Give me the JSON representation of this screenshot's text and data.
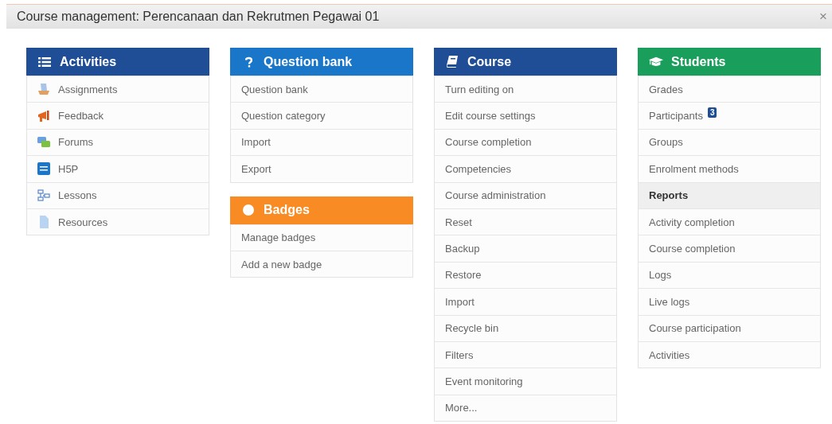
{
  "window": {
    "title": "Course management: Perencanaan dan Rekrutmen Pegawai 01",
    "close": "×"
  },
  "columns": [
    {
      "panels": [
        {
          "title": "Activities",
          "color": "#1f4e96",
          "items": [
            {
              "label": "Assignments",
              "selected": false
            },
            {
              "label": "Feedback",
              "selected": false
            },
            {
              "label": "Forums",
              "selected": false
            },
            {
              "label": "H5P",
              "selected": false
            },
            {
              "label": "Lessons",
              "selected": false
            },
            {
              "label": "Resources",
              "selected": false
            }
          ]
        }
      ]
    },
    {
      "panels": [
        {
          "title": "Question bank",
          "color": "#1a76c8",
          "items": [
            {
              "label": "Question bank",
              "selected": false
            },
            {
              "label": "Question category",
              "selected": false
            },
            {
              "label": "Import",
              "selected": false
            },
            {
              "label": "Export",
              "selected": false
            }
          ]
        },
        {
          "title": "Badges",
          "color": "#f88b23",
          "items": [
            {
              "label": "Manage badges",
              "selected": false
            },
            {
              "label": "Add a new badge",
              "selected": false
            }
          ]
        }
      ]
    },
    {
      "panels": [
        {
          "title": "Course",
          "color": "#1f4e96",
          "items": [
            {
              "label": "Turn editing on",
              "selected": false
            },
            {
              "label": "Edit course settings",
              "selected": false
            },
            {
              "label": "Course completion",
              "selected": false
            },
            {
              "label": "Competencies",
              "selected": false
            },
            {
              "label": "Course administration",
              "selected": false
            },
            {
              "label": "Reset",
              "selected": false
            },
            {
              "label": "Backup",
              "selected": false
            },
            {
              "label": "Restore",
              "selected": false
            },
            {
              "label": "Import",
              "selected": false
            },
            {
              "label": "Recycle bin",
              "selected": false
            },
            {
              "label": "Filters",
              "selected": false
            },
            {
              "label": "Event monitoring",
              "selected": false
            },
            {
              "label": "More...",
              "selected": false
            }
          ]
        }
      ]
    },
    {
      "panels": [
        {
          "title": "Students",
          "color": "#1a9e5c",
          "items": [
            {
              "label": "Grades",
              "selected": false
            },
            {
              "label": "Participants",
              "selected": false,
              "badge": "3"
            },
            {
              "label": "Groups",
              "selected": false
            },
            {
              "label": "Enrolment methods",
              "selected": false
            },
            {
              "label": "Reports",
              "selected": true
            },
            {
              "label": "Activity completion",
              "selected": false
            },
            {
              "label": "Course completion",
              "selected": false
            },
            {
              "label": "Logs",
              "selected": false
            },
            {
              "label": "Live logs",
              "selected": false
            },
            {
              "label": "Course participation",
              "selected": false
            },
            {
              "label": "Activities",
              "selected": false
            }
          ]
        }
      ]
    }
  ]
}
